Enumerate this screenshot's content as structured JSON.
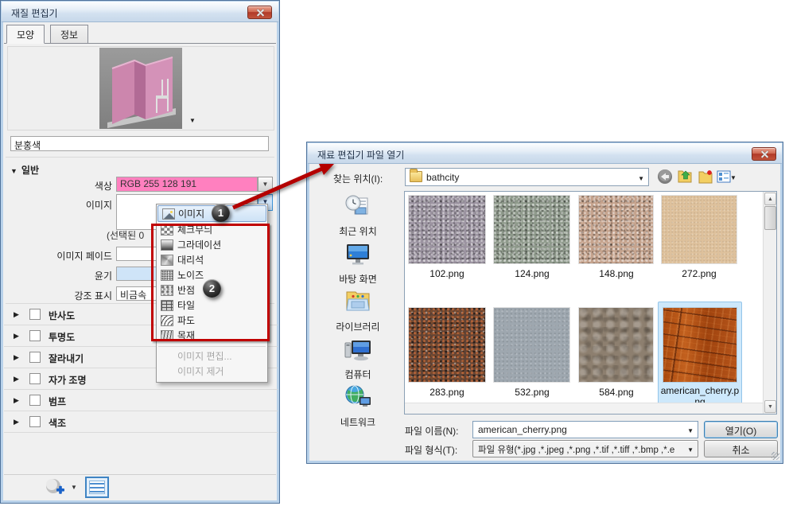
{
  "colors": {
    "annotation_red": "#c00000",
    "selection_blue": "#3c7fb1",
    "material_pink": "#ff80bf"
  },
  "annotations": {
    "badge_1": "1",
    "badge_2": "2"
  },
  "material_editor": {
    "title": "재질 편집기",
    "tabs": [
      {
        "label": "모양"
      },
      {
        "label": "정보"
      }
    ],
    "name_value": "분홍색",
    "general": {
      "header": "일반",
      "color_label": "색상",
      "color_value": "RGB 255 128 191",
      "image_label": "이미지",
      "selected_note": "(선택된 0",
      "image_fade_label": "이미지 페이드",
      "gloss_label": "윤기",
      "highlight_label": "강조 표시",
      "highlight_value": "비금속"
    },
    "sections": [
      "반사도",
      "투명도",
      "잘라내기",
      "자가 조명",
      "범프",
      "색조"
    ],
    "texture_menu": {
      "items": [
        {
          "label": "이미지",
          "icon": "image-icon"
        },
        {
          "label": "체크무늬",
          "icon": "checker-icon"
        },
        {
          "label": "그라데이션",
          "icon": "gradient-icon"
        },
        {
          "label": "대리석",
          "icon": "marble-icon"
        },
        {
          "label": "노이즈",
          "icon": "noise-icon"
        },
        {
          "label": "반점",
          "icon": "speckle-icon"
        },
        {
          "label": "타일",
          "icon": "tile-icon"
        },
        {
          "label": "파도",
          "icon": "wave-icon"
        },
        {
          "label": "목재",
          "icon": "wood-icon"
        }
      ],
      "edit_item": "이미지 편집...",
      "remove_item": "이미지 제거"
    }
  },
  "file_dialog": {
    "title": "재료 편집기 파일 열기",
    "look_in_label": "찾는 위치(I):",
    "folder_name": "bathcity",
    "toolbar_icons": [
      "back-icon",
      "up-folder-icon",
      "new-folder-icon",
      "views-icon"
    ],
    "places": [
      {
        "label": "최근 위치",
        "icon": "recent-places-icon"
      },
      {
        "label": "바탕 화면",
        "icon": "desktop-icon"
      },
      {
        "label": "라이브러리",
        "icon": "libraries-icon"
      },
      {
        "label": "컴퓨터",
        "icon": "computer-icon"
      },
      {
        "label": "네트워크",
        "icon": "network-icon"
      }
    ],
    "files": [
      {
        "name": "102.png"
      },
      {
        "name": "124.png"
      },
      {
        "name": "148.png"
      },
      {
        "name": "272.png"
      },
      {
        "name": "283.png"
      },
      {
        "name": "532.png"
      },
      {
        "name": "584.png"
      },
      {
        "name": "american_cherry.png"
      }
    ],
    "selected_file": "american_cherry.png",
    "file_name_label": "파일 이름(N):",
    "file_name_value": "american_cherry.png",
    "file_type_label": "파일 형식(T):",
    "file_type_value": "파일 유형(*.jpg ,*.jpeg ,*.png ,*.tif ,*.tiff ,*.bmp ,*.e",
    "open_label": "열기(O)",
    "cancel_label": "취소"
  }
}
